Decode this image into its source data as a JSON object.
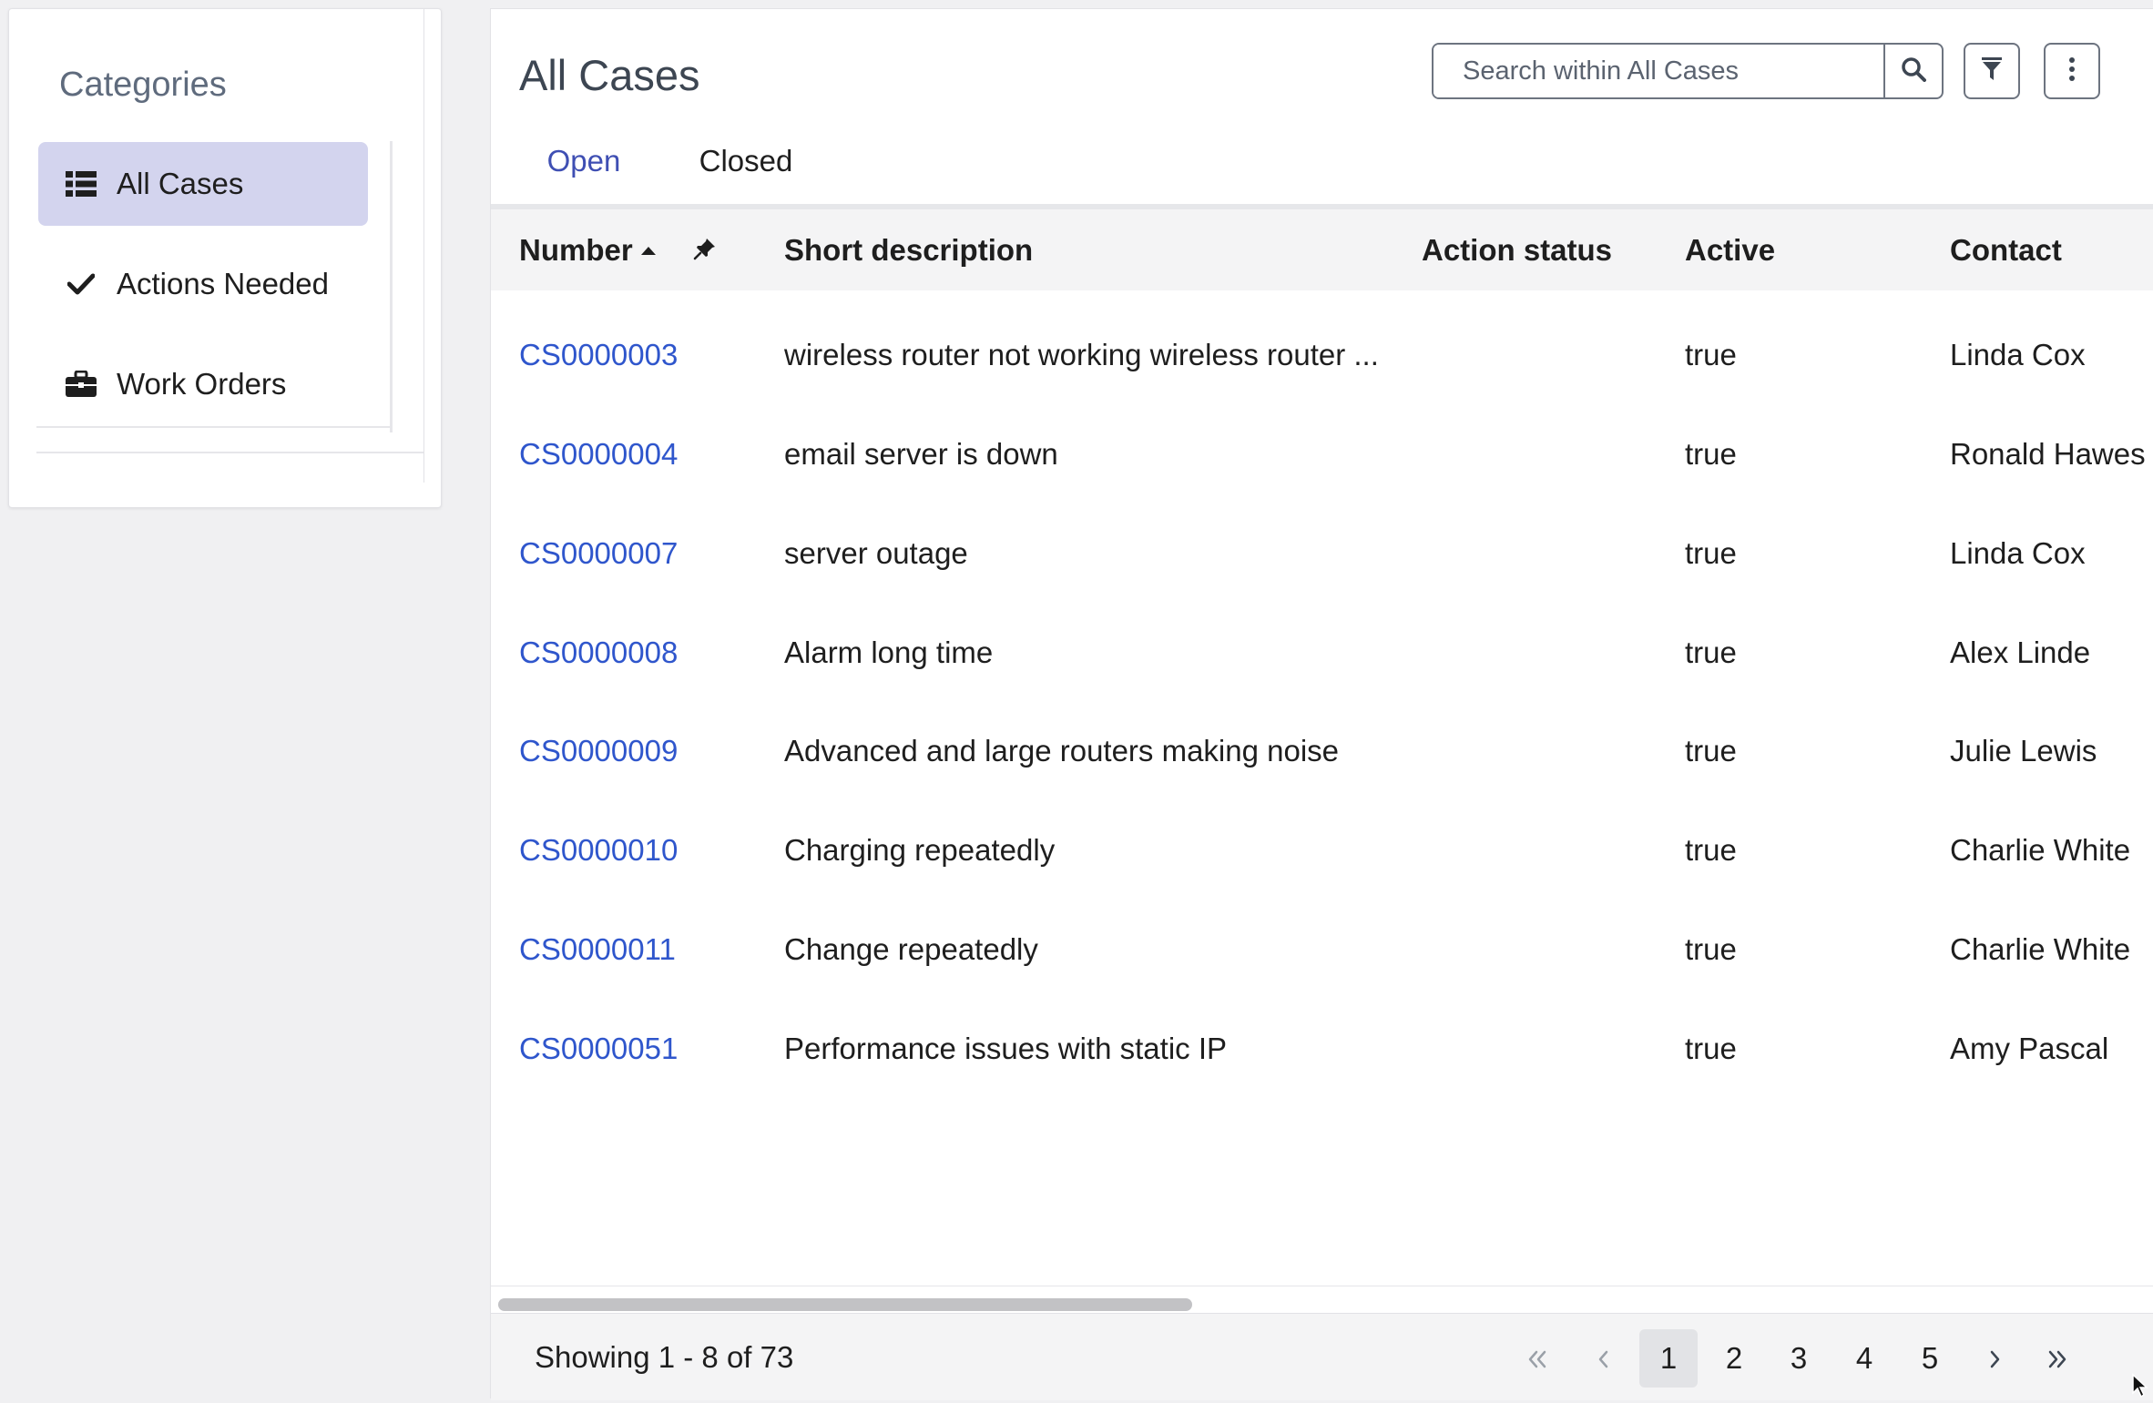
{
  "sidebar": {
    "title": "Categories",
    "items": [
      {
        "label": "All Cases",
        "icon": "list-icon",
        "active": true
      },
      {
        "label": "Actions Needed",
        "icon": "check-icon",
        "active": false
      },
      {
        "label": "Work Orders",
        "icon": "briefcase-icon",
        "active": false
      }
    ]
  },
  "main": {
    "title": "All Cases",
    "search": {
      "placeholder": "Search within All Cases",
      "value": ""
    },
    "tabs": [
      {
        "label": "Open",
        "active": true
      },
      {
        "label": "Closed",
        "active": false
      }
    ],
    "columns": [
      "Number",
      "Short description",
      "Action status",
      "Active",
      "Contact"
    ],
    "sort": {
      "column": "Number",
      "direction": "ascending"
    },
    "rows": [
      {
        "number": "CS0000003",
        "short_description": "wireless router not working wireless router ...",
        "action_status": "",
        "active": "true",
        "contact": "Linda Cox"
      },
      {
        "number": "CS0000004",
        "short_description": "email server is down",
        "action_status": "",
        "active": "true",
        "contact": "Ronald Hawes"
      },
      {
        "number": "CS0000007",
        "short_description": "server outage",
        "action_status": "",
        "active": "true",
        "contact": "Linda Cox"
      },
      {
        "number": "CS0000008",
        "short_description": "Alarm long time",
        "action_status": "",
        "active": "true",
        "contact": "Alex Linde"
      },
      {
        "number": "CS0000009",
        "short_description": "Advanced and large routers making noise",
        "action_status": "",
        "active": "true",
        "contact": "Julie Lewis"
      },
      {
        "number": "CS0000010",
        "short_description": "Charging repeatedly",
        "action_status": "",
        "active": "true",
        "contact": "Charlie White"
      },
      {
        "number": "CS0000011",
        "short_description": "Change repeatedly",
        "action_status": "",
        "active": "true",
        "contact": "Charlie White"
      },
      {
        "number": "CS0000051",
        "short_description": "Performance issues with static IP",
        "action_status": "",
        "active": "true",
        "contact": "Amy Pascal"
      }
    ],
    "footer": {
      "showing": "Showing 1 - 8 of 73",
      "pages": [
        "1",
        "2",
        "3",
        "4",
        "5"
      ],
      "current_page": "1",
      "first_icon": "double-chevron-left-icon",
      "prev_icon": "chevron-left-icon",
      "next_icon": "chevron-right-icon",
      "last_icon": "double-chevron-right-icon"
    }
  },
  "colors": {
    "accent": "#3f4fb3",
    "link": "#2f56cc",
    "active_category_bg": "#d3d4ee"
  }
}
